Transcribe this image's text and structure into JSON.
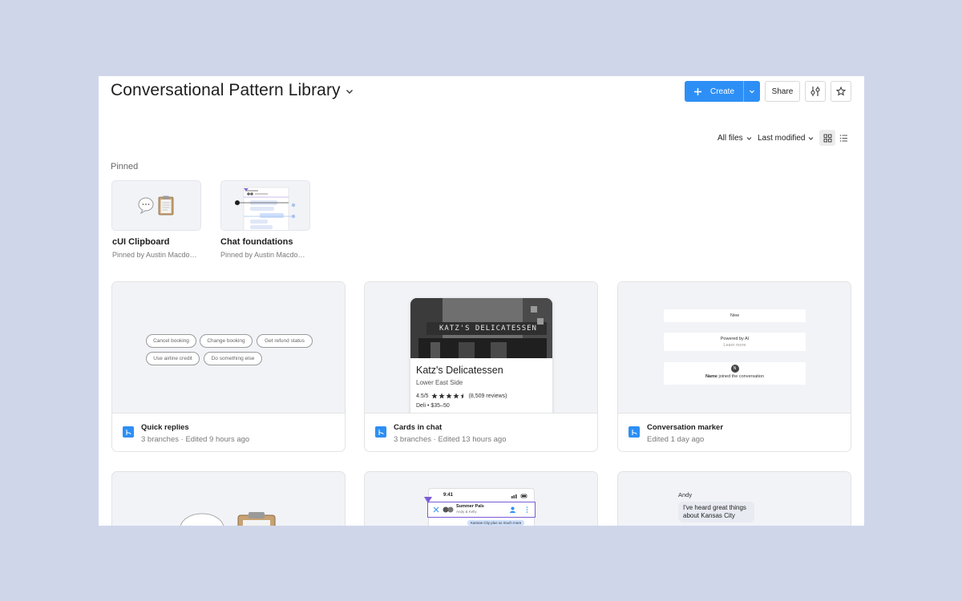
{
  "header": {
    "title": "Conversational Pattern Library",
    "create_label": "Create",
    "share_label": "Share"
  },
  "filters": {
    "files": "All files",
    "sort": "Last modified"
  },
  "pinned": {
    "label": "Pinned",
    "items": [
      {
        "name": "cUI Clipboard",
        "sub": "Pinned by Austin Macdo…"
      },
      {
        "name": "Chat foundations",
        "sub": "Pinned by Austin Macdo…"
      }
    ]
  },
  "cards": [
    {
      "name": "Quick replies",
      "sub": "3 branches · Edited 9 hours ago"
    },
    {
      "name": "Cards in chat",
      "sub": "3 branches · Edited 13 hours ago"
    },
    {
      "name": "Conversation marker",
      "sub": "Edited 1 day ago"
    }
  ],
  "quick_replies": {
    "chips": [
      "Cancel booking",
      "Change booking",
      "Get refund status",
      "Use airline credit",
      "Do something else"
    ]
  },
  "place_card": {
    "sign": "KATZ'S DELICATESSEN",
    "title": "Katz's Delicatessen",
    "area": "Lower East Side",
    "rating": "4.5/5",
    "reviews": "(8,509 reviews)",
    "info": "Deli • $35–50"
  },
  "marker": {
    "new_label": "New",
    "powered": "Powered by AI",
    "learn": "Learn more",
    "avatar_letter": "N",
    "joined_name": "Name",
    "joined_text": " joined the conversation"
  },
  "chat_preview": {
    "time": "9:41",
    "group_name": "Summer Pals",
    "members": "Andy & Kelly",
    "bubble": "Kansas City plus so much more"
  },
  "andy_preview": {
    "sender": "Andy",
    "message": "I've heard great things about Kansas City"
  },
  "colors": {
    "background": "#d0d6ea",
    "accent": "#2d8ff5",
    "thumb_bg": "#f1f3f7"
  },
  "icons": {
    "title_dropdown": "chevron-down-icon",
    "create_plus": "plus-icon",
    "settings": "sliders-icon",
    "favorite": "star-icon",
    "grid_view": "grid-icon",
    "list_view": "list-icon",
    "branch": "branch-icon"
  }
}
